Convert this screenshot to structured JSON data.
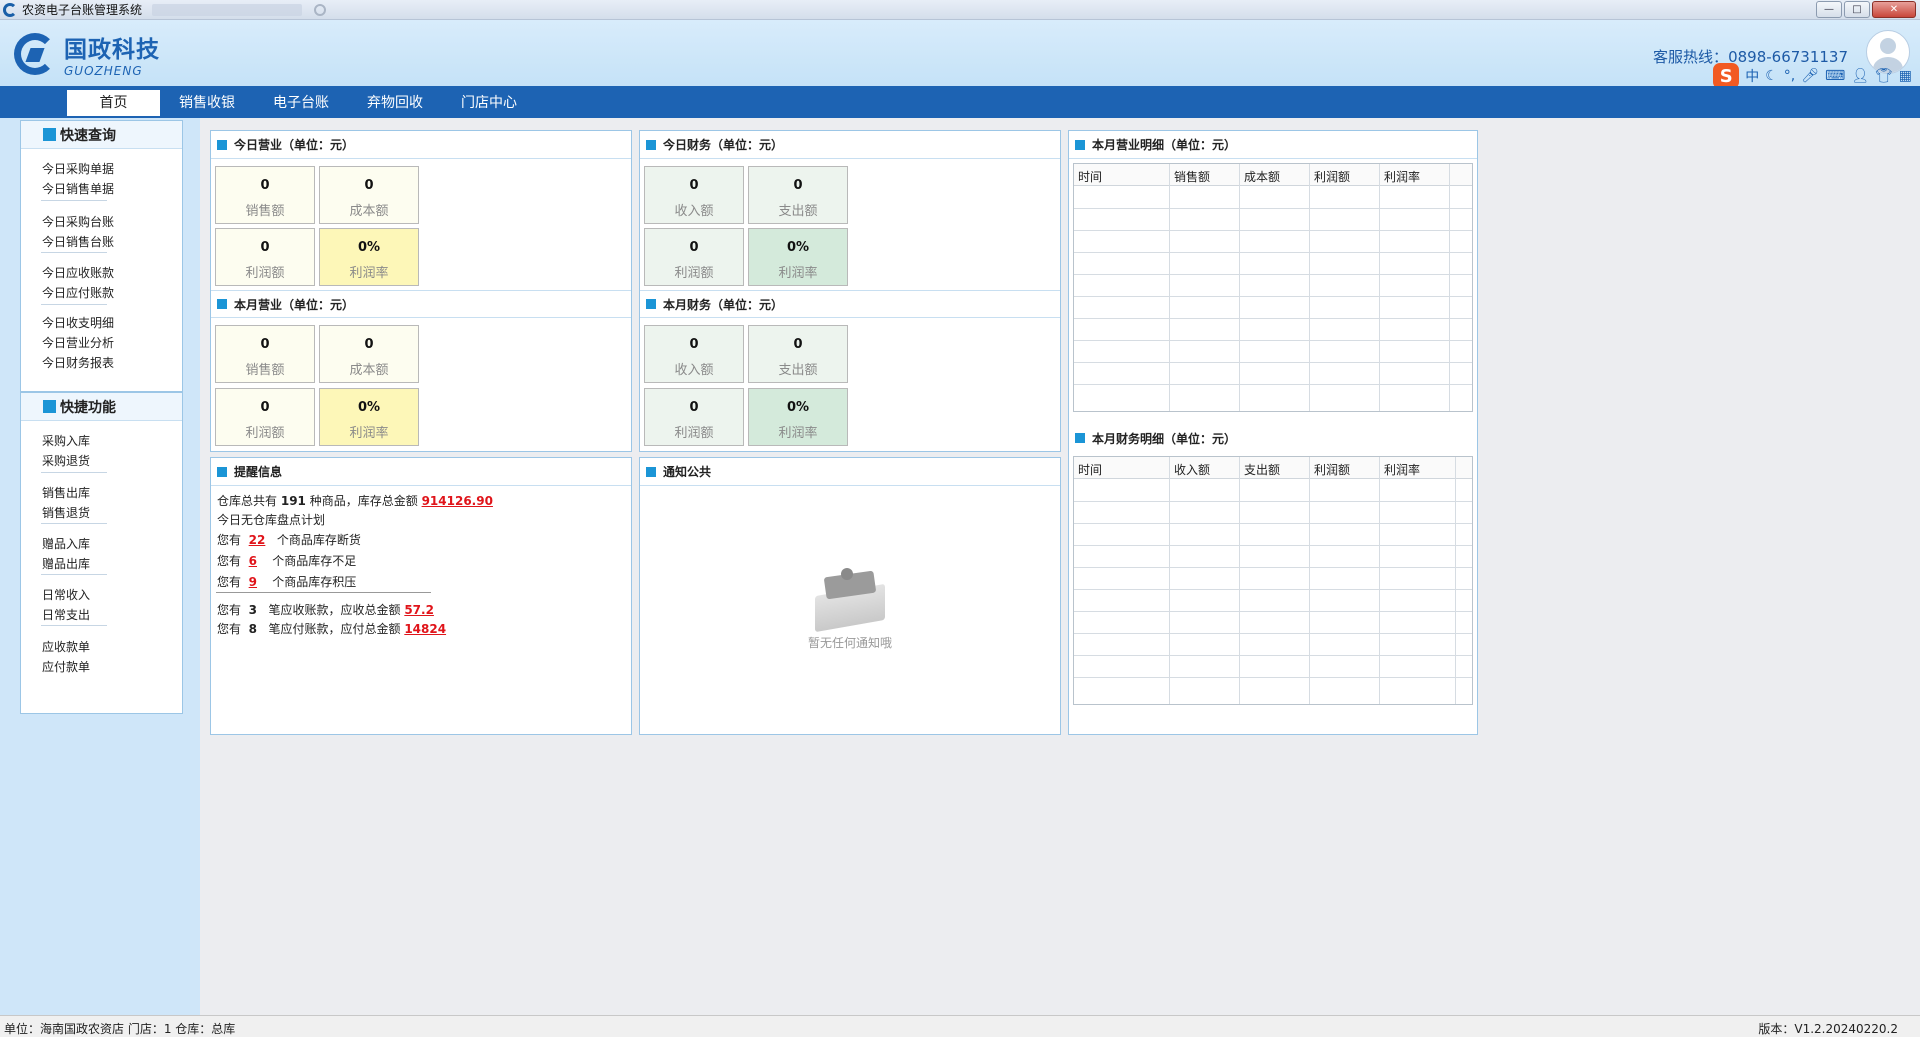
{
  "window": {
    "title": "农资电子台账管理系统"
  },
  "header": {
    "logo_cn": "国政科技",
    "logo_en": "GUOZHENG",
    "hotline_label": "客服热线：",
    "hotline_number": "0898-66731137",
    "ime_chars": [
      "中"
    ]
  },
  "nav": [
    "首页",
    "销售收银",
    "电子台账",
    "弃物回收",
    "门店中心"
  ],
  "sidebar": {
    "quick_query_title": "快速查询",
    "quick_query_items": [
      "今日采购单据",
      "今日销售单据",
      "今日采购台账",
      "今日销售台账",
      "今日应收账款",
      "今日应付账款",
      "今日收支明细",
      "今日营业分析",
      "今日财务报表"
    ],
    "quick_func_title": "快捷功能",
    "quick_func_items": [
      "采购入库",
      "采购退货",
      "销售出库",
      "销售退货",
      "赠品入库",
      "赠品出库",
      "日常收入",
      "日常支出",
      "应收款单",
      "应付款单"
    ]
  },
  "today_business": {
    "title": "今日营业（单位：元）",
    "sales": {
      "value": "0",
      "label": "销售额"
    },
    "cost": {
      "value": "0",
      "label": "成本额"
    },
    "profit": {
      "value": "0",
      "label": "利润额"
    },
    "rate": {
      "value": "0%",
      "label": "利润率"
    }
  },
  "month_business": {
    "title": "本月营业（单位：元）",
    "sales": {
      "value": "0",
      "label": "销售额"
    },
    "cost": {
      "value": "0",
      "label": "成本额"
    },
    "profit": {
      "value": "0",
      "label": "利润额"
    },
    "rate": {
      "value": "0%",
      "label": "利润率"
    }
  },
  "today_finance": {
    "title": "今日财务（单位：元）",
    "income": {
      "value": "0",
      "label": "收入额"
    },
    "expense": {
      "value": "0",
      "label": "支出额"
    },
    "profit": {
      "value": "0",
      "label": "利润额"
    },
    "rate": {
      "value": "0%",
      "label": "利润率"
    }
  },
  "month_finance": {
    "title": "本月财务（单位：元）",
    "income": {
      "value": "0",
      "label": "收入额"
    },
    "expense": {
      "value": "0",
      "label": "支出额"
    },
    "profit": {
      "value": "0",
      "label": "利润额"
    },
    "rate": {
      "value": "0%",
      "label": "利润率"
    }
  },
  "month_business_detail": {
    "title": "本月营业明细（单位：元）",
    "columns": [
      "时间",
      "销售额",
      "成本额",
      "利润额",
      "利润率"
    ]
  },
  "month_finance_detail": {
    "title": "本月财务明细（单位：元）",
    "columns": [
      "时间",
      "收入额",
      "支出额",
      "利润额",
      "利润率"
    ]
  },
  "reminder": {
    "title": "提醒信息",
    "line1_a": "仓库总共有",
    "line1_count": "191",
    "line1_b": "种商品，库存总金额",
    "line1_amount": "914126.90",
    "line2": "今日无仓库盘点计划",
    "you": "您有",
    "out_count": "22",
    "out_text": "个商品库存断货",
    "low_count": "6",
    "low_text": "个商品库存不足",
    "over_count": "9",
    "over_text": "个商品库存积压",
    "recv_count": "3",
    "recv_text": "笔应收账款，应收总金额",
    "recv_amount": "57.2",
    "pay_count": "8",
    "pay_text": "笔应付账款，应付总金额",
    "pay_amount": "14824"
  },
  "notice": {
    "title": "通知公共",
    "empty_text": "暂无任何通知哦"
  },
  "statusbar": {
    "left": "单位：海南国政农资店  门店：1  仓库：总库",
    "right": "版本：V1.2.20240220.2"
  }
}
